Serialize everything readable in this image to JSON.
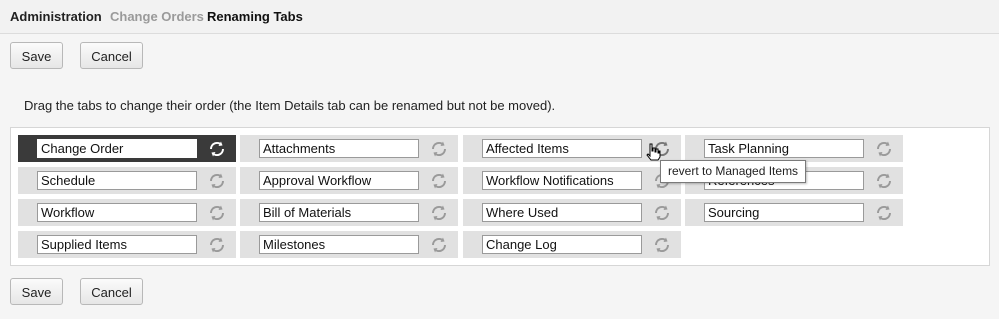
{
  "breadcrumb": {
    "items": [
      "Administration",
      "Change Orders",
      "Renaming Tabs"
    ]
  },
  "toolbar": {
    "save_label": "Save",
    "cancel_label": "Cancel"
  },
  "instructions": "Drag the tabs to change their order (the Item Details tab can be renamed but not be moved).",
  "tabs": {
    "col1": [
      "Change Order",
      "Schedule",
      "Workflow",
      "Supplied Items"
    ],
    "col2": [
      "Attachments",
      "Approval Workflow",
      "Bill of Materials",
      "Milestones"
    ],
    "col3": [
      "Affected Items",
      "Workflow Notifications",
      "Where Used",
      "Change Log"
    ],
    "col4": [
      "Task Planning",
      "References",
      "Sourcing"
    ]
  },
  "tooltip": "revert to Managed Items",
  "colors": {
    "active_tab": "#3a3a3a",
    "tab_bg": "#e1e1e1",
    "muted_crumb": "#9a9a9a"
  }
}
